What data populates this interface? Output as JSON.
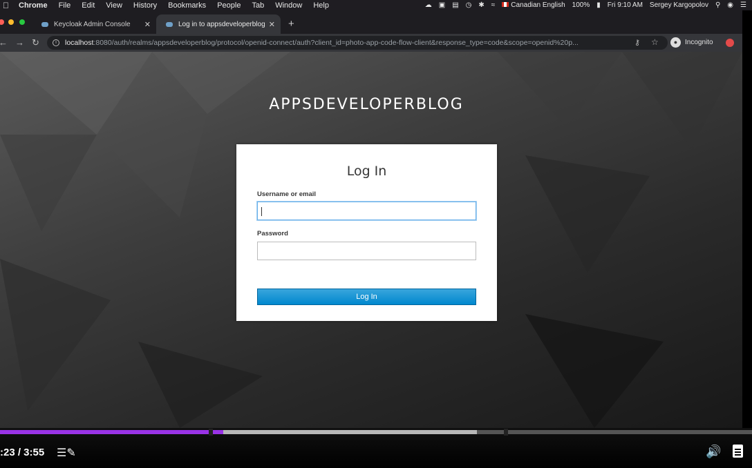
{
  "menubar": {
    "app": "Chrome",
    "menus": [
      "File",
      "Edit",
      "View",
      "History",
      "Bookmarks",
      "People",
      "Tab",
      "Window",
      "Help"
    ],
    "input_source": "Canadian English",
    "battery": "100%",
    "clock": "Fri 9:10 AM",
    "user": "Sergey Kargopolov"
  },
  "browser": {
    "tabs": [
      {
        "title": "Keycloak Admin Console",
        "active": false
      },
      {
        "title": "Log in to appsdeveloperblog",
        "active": true
      }
    ],
    "url_host": "localhost",
    "url_rest": ":8080/auth/realms/appsdeveloperblog/protocol/openid-connect/auth?client_id=photo-app-code-flow-client&response_type=code&scope=openid%20p...",
    "incognito_label": "Incognito"
  },
  "page": {
    "realm_title": "APPSDEVELOPERBLOG",
    "form": {
      "heading": "Log In",
      "username_label": "Username or email",
      "username_value": "",
      "password_label": "Password",
      "password_value": "",
      "submit_label": "Log In"
    }
  },
  "player": {
    "time": ":23 / 3:55",
    "played_fraction": 0.297,
    "buffered_fraction": 0.634
  },
  "colors": {
    "progress": "#9933e6",
    "button": "#0088ce"
  }
}
